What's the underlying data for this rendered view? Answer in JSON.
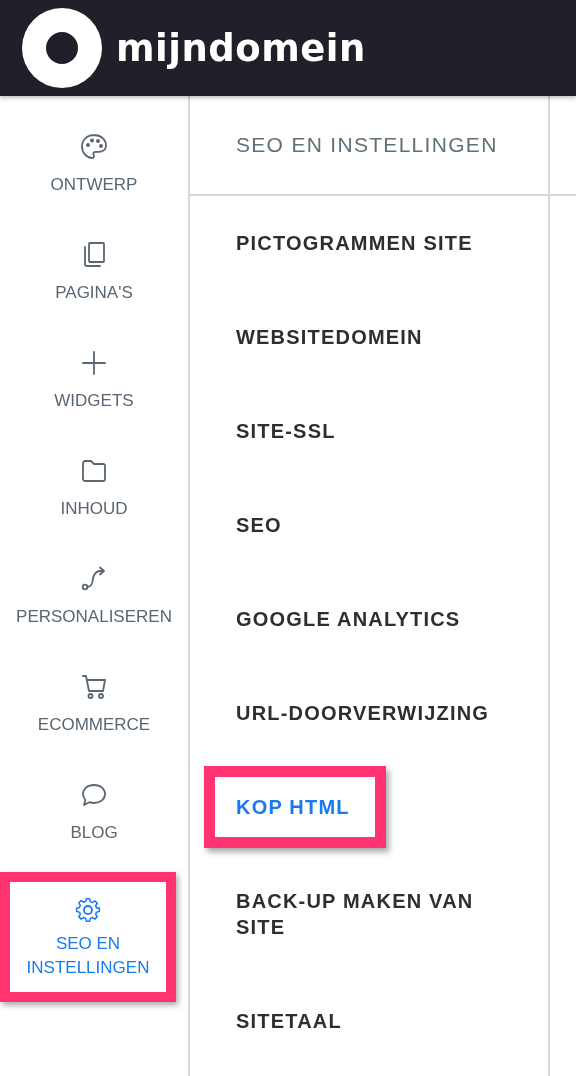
{
  "header": {
    "logo_text": "mijndomein"
  },
  "sidebar": {
    "items": [
      {
        "label": "ONTWERP",
        "selected": false,
        "highlighted": false
      },
      {
        "label": "PAGINA'S",
        "selected": false,
        "highlighted": false
      },
      {
        "label": "WIDGETS",
        "selected": false,
        "highlighted": false
      },
      {
        "label": "INHOUD",
        "selected": false,
        "highlighted": false
      },
      {
        "label": "PERSONALISEREN",
        "selected": false,
        "highlighted": false
      },
      {
        "label": "ECOMMERCE",
        "selected": false,
        "highlighted": false
      },
      {
        "label": "BLOG",
        "selected": false,
        "highlighted": false
      },
      {
        "label": "SEO EN INSTELLINGEN",
        "selected": true,
        "highlighted": true
      }
    ]
  },
  "panel": {
    "title": "SEO EN INSTELLINGEN",
    "items": [
      {
        "label": "PICTOGRAMMEN SITE",
        "selected": false,
        "highlighted": false
      },
      {
        "label": "WEBSITEDOMEIN",
        "selected": false,
        "highlighted": false
      },
      {
        "label": "SITE-SSL",
        "selected": false,
        "highlighted": false
      },
      {
        "label": "SEO",
        "selected": false,
        "highlighted": false
      },
      {
        "label": "GOOGLE ANALYTICS",
        "selected": false,
        "highlighted": false
      },
      {
        "label": "URL-DOORVERWIJZING",
        "selected": false,
        "highlighted": false
      },
      {
        "label": "KOP HTML",
        "selected": true,
        "highlighted": true
      },
      {
        "label": "BACK-UP MAKEN VAN SITE",
        "selected": false,
        "highlighted": false
      },
      {
        "label": "SITETAAL",
        "selected": false,
        "highlighted": false
      }
    ]
  }
}
